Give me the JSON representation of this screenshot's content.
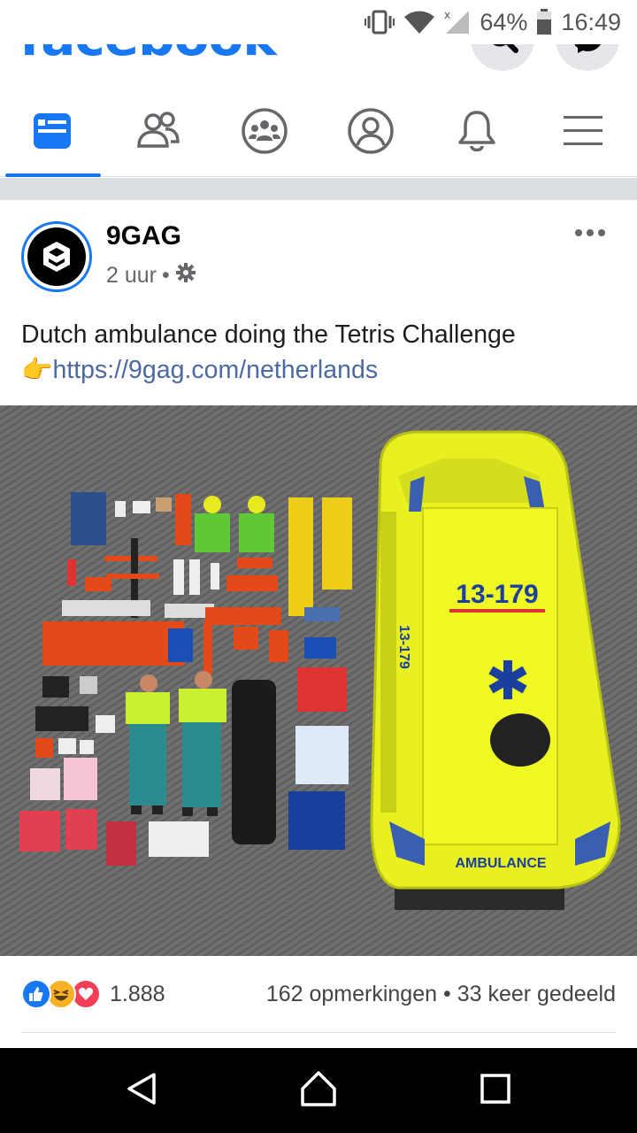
{
  "status_bar": {
    "battery": "64%",
    "time": "16:49"
  },
  "header": {
    "logo": "facebook"
  },
  "tabs": [
    {
      "name": "news-feed",
      "active": true
    },
    {
      "name": "friends",
      "active": false
    },
    {
      "name": "groups",
      "active": false
    },
    {
      "name": "profile",
      "active": false
    },
    {
      "name": "notifications",
      "active": false
    },
    {
      "name": "menu",
      "active": false
    }
  ],
  "post": {
    "author": "9GAG",
    "time": "2 uur",
    "separator": "•",
    "text": "Dutch ambulance doing the Tetris Challenge",
    "emoji": "👉",
    "link": "https://9gag.com/netherlands",
    "image": {
      "ambulance_number": "13-179",
      "ambulance_side_number": "13-179",
      "ambulance_rear_text": "AMBULANCE"
    },
    "reaction_count": "1.888",
    "comments": "162 opmerkingen",
    "shares": "33 keer gedeeld"
  },
  "colors": {
    "brand": "#1877f2",
    "link": "#4b69a3",
    "divider": "#dadde1",
    "ambulance_yellow": "#e8f020"
  }
}
